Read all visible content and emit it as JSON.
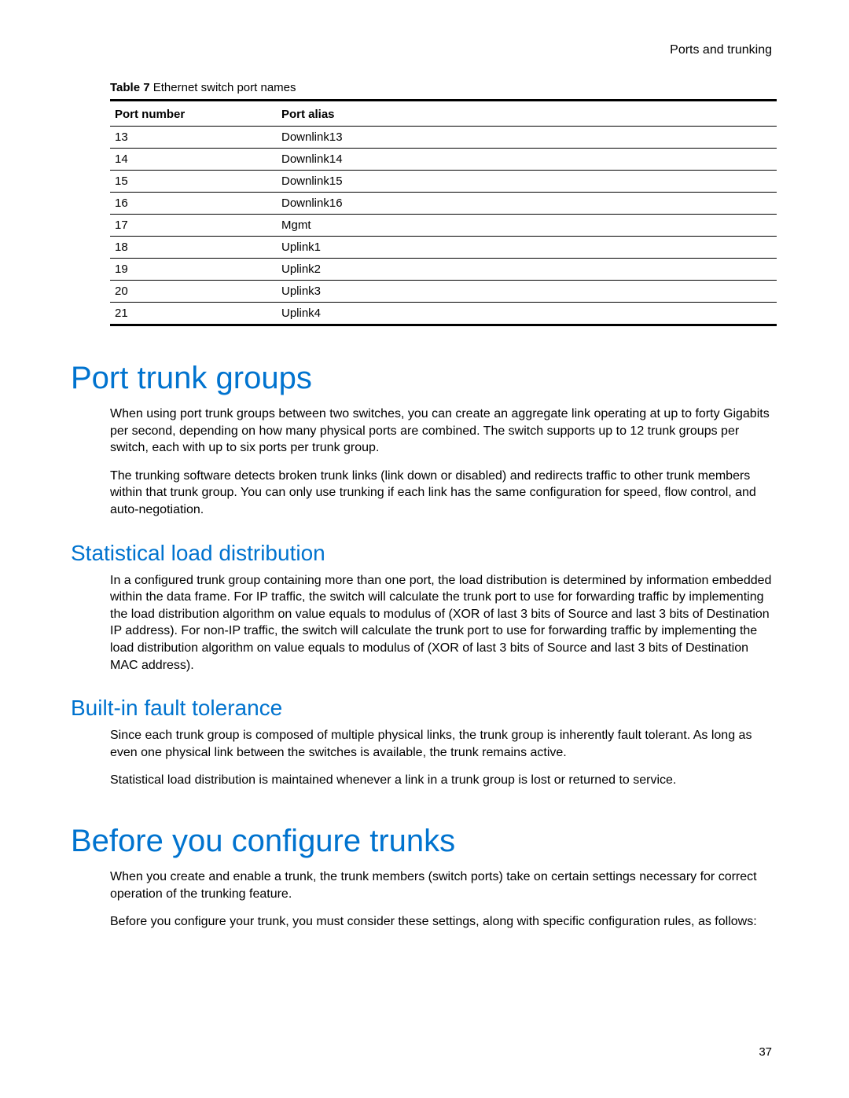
{
  "header": "Ports and trunking",
  "table": {
    "caption_bold": "Table 7",
    "caption_rest": "Ethernet switch port names",
    "headers": {
      "col1": "Port number",
      "col2": "Port alias"
    },
    "rows": [
      {
        "num": "13",
        "alias": "Downlink13"
      },
      {
        "num": "14",
        "alias": "Downlink14"
      },
      {
        "num": "15",
        "alias": "Downlink15"
      },
      {
        "num": "16",
        "alias": "Downlink16"
      },
      {
        "num": "17",
        "alias": "Mgmt"
      },
      {
        "num": "18",
        "alias": "Uplink1"
      },
      {
        "num": "19",
        "alias": "Uplink2"
      },
      {
        "num": "20",
        "alias": "Uplink3"
      },
      {
        "num": "21",
        "alias": "Uplink4"
      }
    ]
  },
  "sections": {
    "port_trunk_groups": {
      "title": "Port trunk groups",
      "p1": "When using port trunk groups between two switches, you can create an aggregate link operating at up to forty Gigabits per second, depending on how many physical ports are combined. The switch supports up to 12 trunk groups per switch, each with up to six ports per trunk group.",
      "p2": "The trunking software detects broken trunk links (link down or disabled) and redirects traffic to other trunk members within that trunk group. You can only use trunking if each link has the same configuration for speed, flow control, and auto-negotiation."
    },
    "stat_load": {
      "title": "Statistical load distribution",
      "p1": "In a configured trunk group containing more than one port, the load distribution is determined by information embedded within the data frame. For IP traffic, the switch will calculate the trunk port to use for forwarding traffic by implementing the load distribution algorithm on value equals to modulus of (XOR of last 3 bits of Source and last 3 bits of Destination IP address). For non-IP traffic, the switch will calculate the trunk port to use for forwarding traffic by implementing the load distribution algorithm on value equals to modulus of (XOR of last 3 bits of Source and last 3 bits of Destination MAC address)."
    },
    "fault_tolerance": {
      "title": "Built-in fault tolerance",
      "p1": "Since each trunk group is composed of multiple physical links, the trunk group is inherently fault tolerant. As long as even one physical link between the switches is available, the trunk remains active.",
      "p2": "Statistical load distribution is maintained whenever a link in a trunk group is lost or returned to service."
    },
    "before_configure": {
      "title": "Before you configure trunks",
      "p1": "When you create and enable a trunk, the trunk members (switch ports) take on certain settings necessary for correct operation of the trunking feature.",
      "p2": "Before you configure your trunk, you must consider these settings, along with specific configuration rules, as follows:"
    }
  },
  "page_number": "37"
}
